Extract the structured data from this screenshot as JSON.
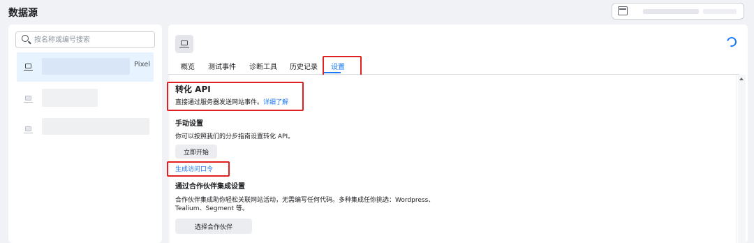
{
  "page": {
    "title": "数据源"
  },
  "search": {
    "placeholder": "按名称或编号搜索"
  },
  "sources": [
    {
      "label": "Pixel",
      "selected": true
    }
  ],
  "tabs": [
    {
      "label": "概览"
    },
    {
      "label": "测试事件"
    },
    {
      "label": "诊断工具"
    },
    {
      "label": "历史记录"
    },
    {
      "label": "设置",
      "active": true
    }
  ],
  "conversion_api": {
    "heading": "转化 API",
    "description": "直接通过服务器发送网站事件。",
    "learn_more": "详细了解"
  },
  "manual_setup": {
    "heading": "手动设置",
    "description": "你可以按照我们的分步指南设置转化 API。",
    "start_button": "立即开始",
    "generate_token_link": "生成访问口令"
  },
  "partner_setup": {
    "heading": "通过合作伙伴集成设置",
    "description_line1": "合作伙伴集成助你轻松关联网站活动，无需编写任何代码。多种集成任你挑选：Wordpress、",
    "description_line2": "Tealium、Segment 等。",
    "choose_button": "选择合作伙伴"
  },
  "colors": {
    "accent": "#1877f2",
    "highlight": "#e02020"
  }
}
